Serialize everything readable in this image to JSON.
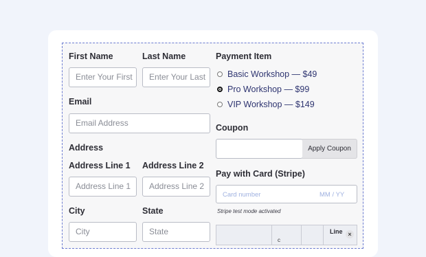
{
  "form": {
    "first_name": {
      "label": "First Name",
      "placeholder": "Enter Your First"
    },
    "last_name": {
      "label": "Last Name",
      "placeholder": "Enter Your Last"
    },
    "email": {
      "label": "Email",
      "placeholder": "Email Address"
    },
    "address": {
      "label": "Address",
      "line1": {
        "label": "Address Line 1",
        "placeholder": "Address Line 1"
      },
      "line2": {
        "label": "Address Line 2",
        "placeholder": "Address Line 2"
      },
      "city": {
        "label": "City",
        "placeholder": "City"
      },
      "state": {
        "label": "State",
        "placeholder": "State"
      }
    },
    "payment": {
      "label": "Payment Item",
      "options": [
        {
          "label": "Basic Workshop — $49",
          "selected": false
        },
        {
          "label": "Pro Workshop — $99",
          "selected": true
        },
        {
          "label": "VIP Workshop — $149",
          "selected": false
        }
      ]
    },
    "coupon": {
      "label": "Coupon",
      "value": "",
      "apply_label": "Apply Coupon"
    },
    "stripe": {
      "label": "Pay with Card (Stripe)",
      "card_placeholder": "Card number",
      "exp_placeholder": "MM / YY",
      "note": "Stripe test mode activated"
    },
    "table": {
      "header": "Line",
      "close_symbol": "×",
      "small": "c"
    }
  }
}
